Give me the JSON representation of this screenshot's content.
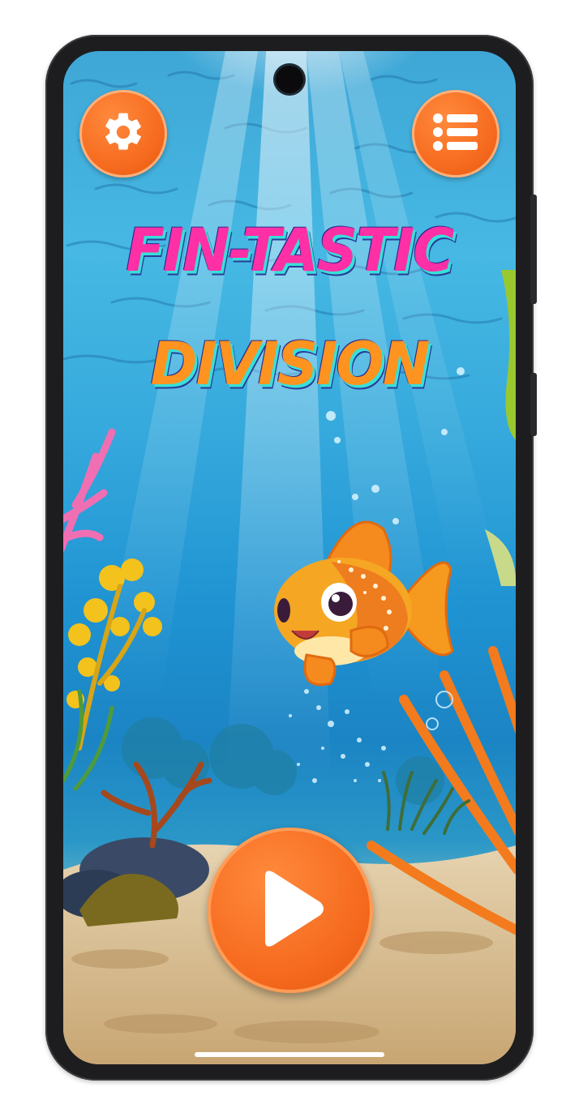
{
  "title": {
    "line1": "Fin-tastic",
    "line2": "Division"
  },
  "buttons": {
    "settings": "settings-icon",
    "menu": "list-menu-icon",
    "play": "play-icon"
  },
  "colors": {
    "button_orange": "#f66b1f",
    "title_pink": "#ff2fa6",
    "title_orange": "#ff9320",
    "title_outline": "#37e0d8"
  }
}
